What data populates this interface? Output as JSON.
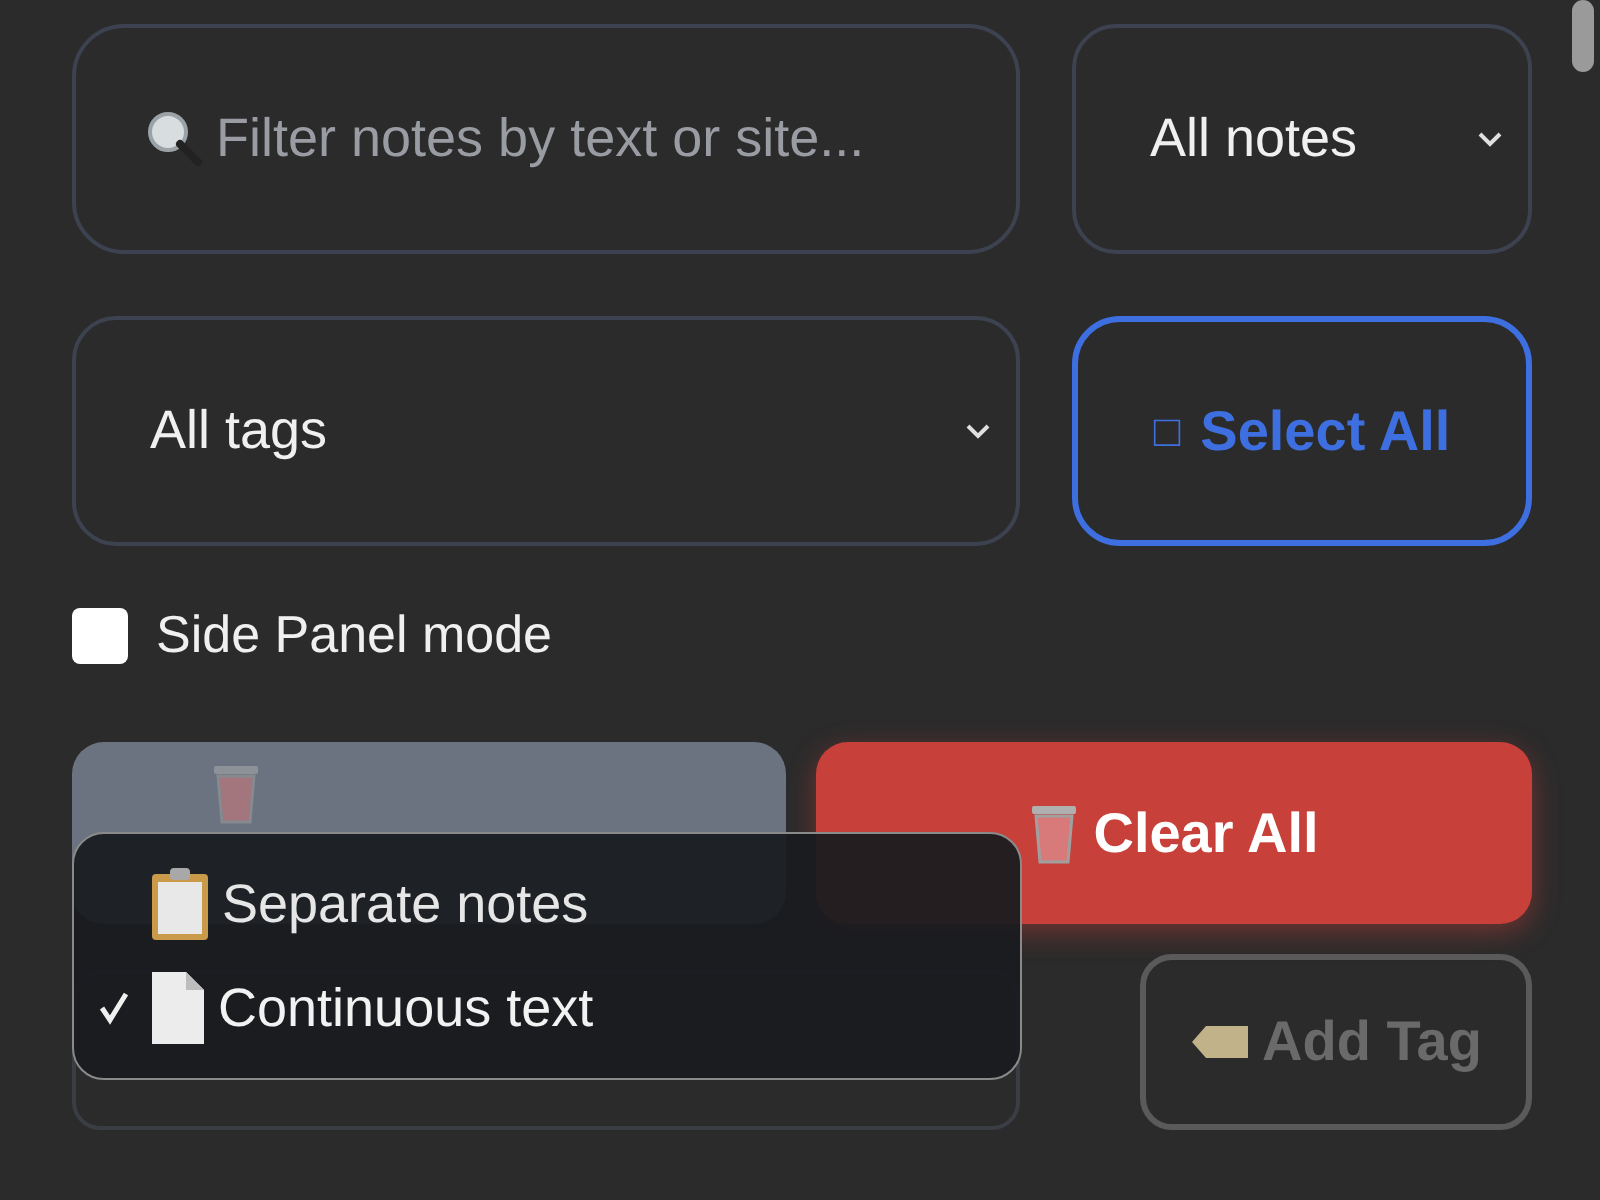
{
  "search": {
    "placeholder": "Filter notes by text or site..."
  },
  "notes_filter": {
    "value": "All notes"
  },
  "tags_filter": {
    "value": "All tags"
  },
  "select_all": {
    "glyph": "□",
    "label": "Select All"
  },
  "side_panel": {
    "label": "Side Panel mode",
    "checked": false
  },
  "delete_selected": {
    "disabled": true
  },
  "clear_all": {
    "label": "Clear All"
  },
  "add_tag": {
    "label": "Add Tag",
    "disabled": true
  },
  "mode_menu": {
    "items": [
      {
        "label": "Separate notes",
        "selected": false,
        "kind": "clipboard"
      },
      {
        "label": "Continuous text",
        "selected": true,
        "kind": "page"
      }
    ]
  }
}
